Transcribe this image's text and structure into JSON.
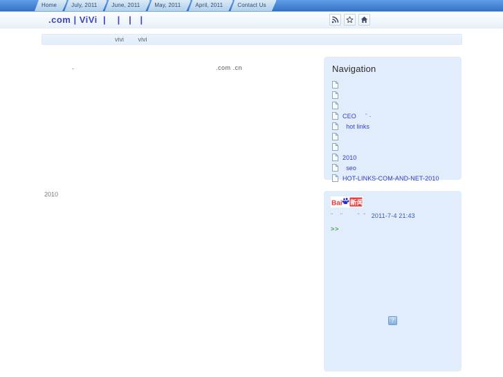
{
  "tabs": [
    {
      "label": "Home"
    },
    {
      "label": "July, 2011"
    },
    {
      "label": "June, 2011"
    },
    {
      "label": "May, 2011"
    },
    {
      "label": "April, 2011"
    },
    {
      "label": "Contact Us"
    }
  ],
  "header": {
    "title": ".com | ViVi  |    |   |   |",
    "icons": [
      {
        "name": "rss-icon",
        "label": "RSS"
      },
      {
        "name": "star-icon",
        "label": "Favorite"
      },
      {
        "name": "home-icon",
        "label": "Home"
      }
    ]
  },
  "subnav": {
    "links": [
      {
        "label": "vivi"
      },
      {
        "label": "vivi"
      }
    ]
  },
  "main": {
    "dash": "-",
    "domains": ".com .cn",
    "year": "2010"
  },
  "sidebar": {
    "navigation": {
      "title": "Navigation",
      "items": [
        {
          "label": ""
        },
        {
          "label": ""
        },
        {
          "label": ""
        },
        {
          "label": "CEO     ¨ ·"
        },
        {
          "label": "  hot links"
        },
        {
          "label": ""
        },
        {
          "label": ""
        },
        {
          "label": "2010"
        },
        {
          "label": "  seo"
        },
        {
          "label": "HOT-LINKS-COM-AND-NET-2010"
        }
      ]
    },
    "news": {
      "logo_text": "Bai",
      "logo_text2": "新闻",
      "line": "¨    ¨        ¨  ¨   2011-7-4 21:43",
      "date": "2011-7-4 21:43",
      "more": ">>",
      "broken_image": "?"
    }
  },
  "colors": {
    "tab_strip": "#4a8ad8",
    "panel_bg": "#e2edfb",
    "link_blue": "#2b3ecb",
    "title_blue": "#3a42c8",
    "green": "#4aa84a",
    "baidu_red": "#e4393c",
    "baidu_blue": "#2b2bd0"
  }
}
